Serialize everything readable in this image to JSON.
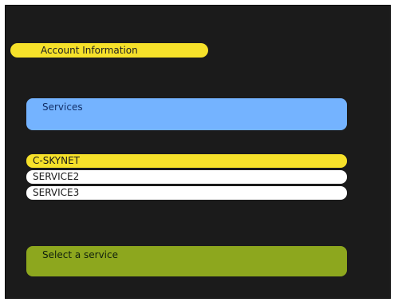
{
  "header": {
    "title": "Account Information"
  },
  "services_panel": {
    "label": "Services"
  },
  "service_list": {
    "items": [
      {
        "label": "C-SKYNET",
        "selected": true
      },
      {
        "label": "SERVICE2",
        "selected": false
      },
      {
        "label": "SERVICE3",
        "selected": false
      }
    ]
  },
  "status": {
    "message": "Select a service"
  },
  "colors": {
    "background": "#1b1b1b",
    "highlight": "#f6e12a",
    "services_panel": "#74b3ff",
    "item_default": "#ffffff",
    "status_panel": "#8da71e"
  }
}
